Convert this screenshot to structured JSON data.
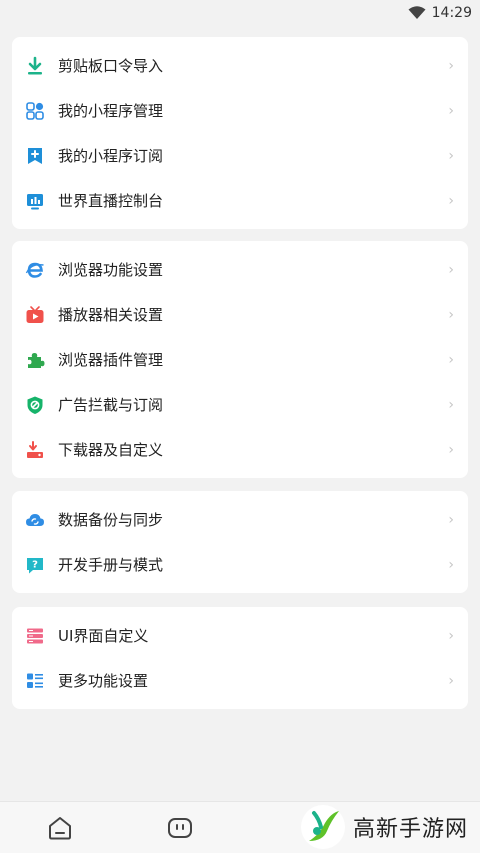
{
  "status": {
    "time": "14:29"
  },
  "groups": [
    {
      "items": [
        {
          "label": "剪贴板口令导入",
          "icon": "download-icon"
        },
        {
          "label": "我的小程序管理",
          "icon": "apps-grid-icon"
        },
        {
          "label": "我的小程序订阅",
          "icon": "subscribe-plus-icon"
        },
        {
          "label": "世界直播控制台",
          "icon": "live-console-icon"
        }
      ]
    },
    {
      "items": [
        {
          "label": "浏览器功能设置",
          "icon": "browser-e-icon"
        },
        {
          "label": "播放器相关设置",
          "icon": "tv-play-icon"
        },
        {
          "label": "浏览器插件管理",
          "icon": "puzzle-icon"
        },
        {
          "label": "广告拦截与订阅",
          "icon": "shield-block-icon"
        },
        {
          "label": "下载器及自定义",
          "icon": "downloader-icon"
        }
      ]
    },
    {
      "items": [
        {
          "label": "数据备份与同步",
          "icon": "cloud-sync-icon"
        },
        {
          "label": "开发手册与模式",
          "icon": "help-chat-icon"
        }
      ]
    },
    {
      "items": [
        {
          "label": "UI界面自定义",
          "icon": "ui-layout-icon"
        },
        {
          "label": "更多功能设置",
          "icon": "more-list-icon"
        }
      ]
    }
  ],
  "watermark": {
    "text": "高新手游网"
  },
  "colors": {
    "accent_green": "#1cb38a",
    "accent_blue": "#2f8de4",
    "accent_red": "#f0514b",
    "background": "#f2f2f2"
  }
}
